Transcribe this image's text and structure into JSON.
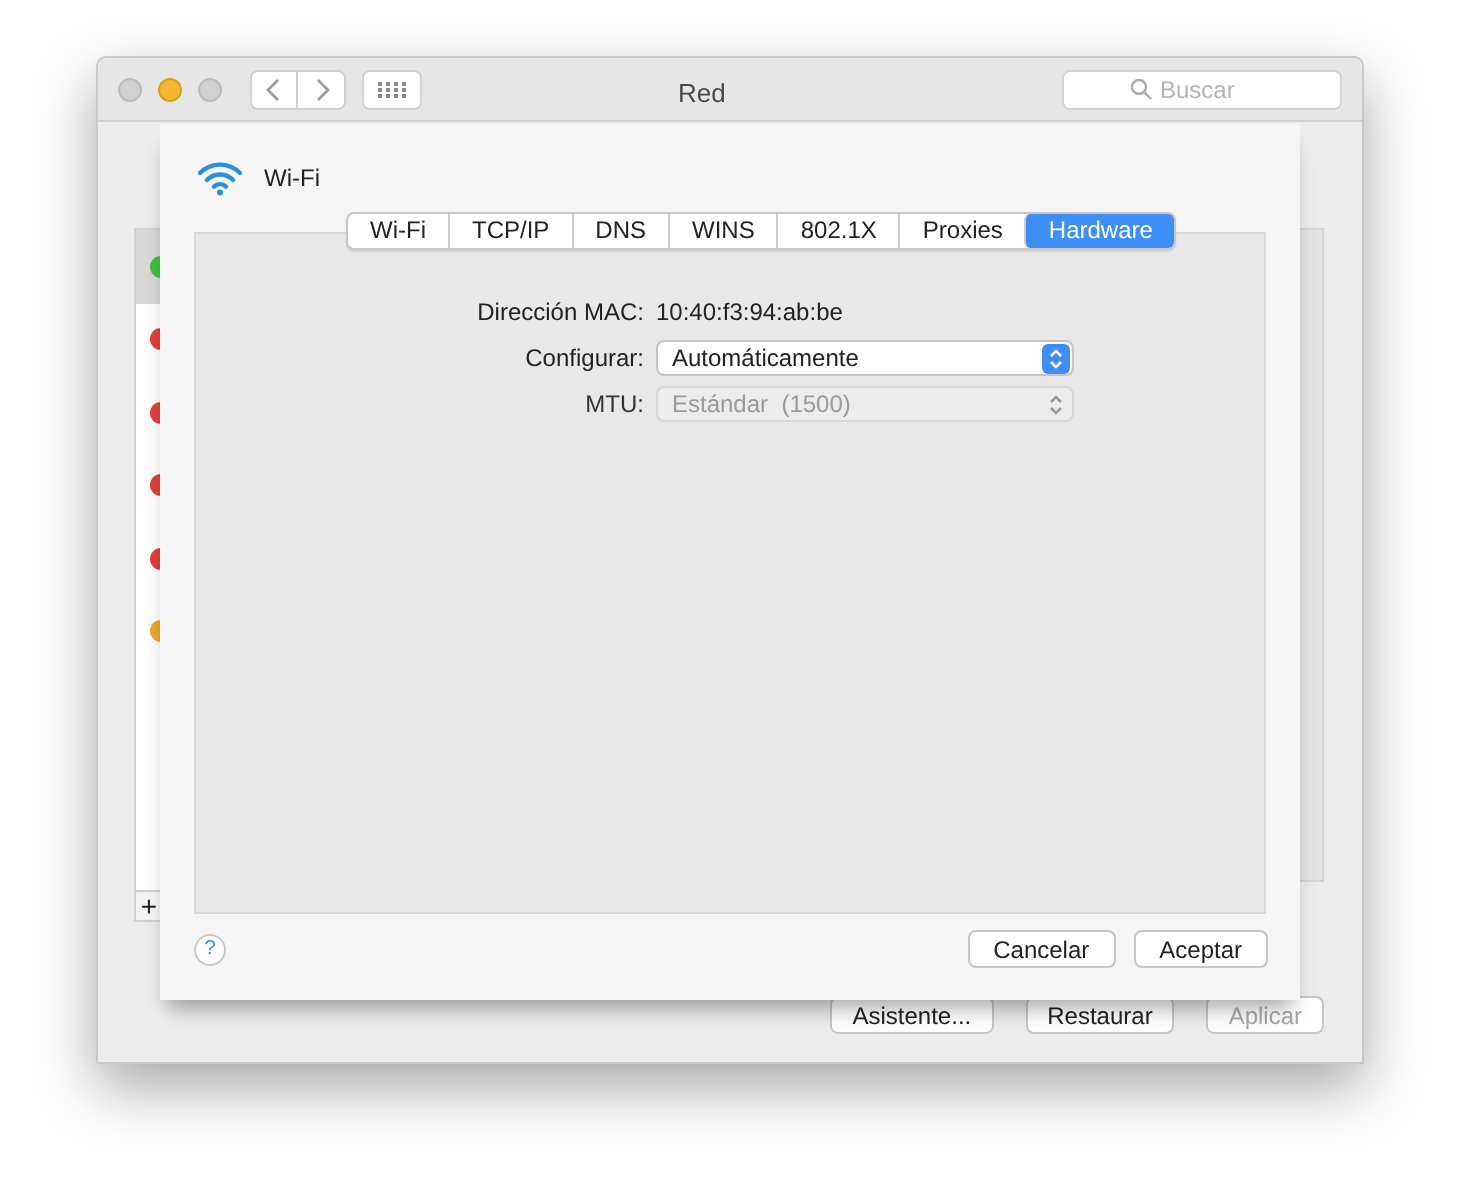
{
  "window": {
    "title": "Red",
    "search": {
      "placeholder": "Buscar"
    }
  },
  "services": [
    {
      "color": "#3fbf3f",
      "selected": true
    },
    {
      "color": "#e0403a",
      "selected": false
    },
    {
      "color": "#e0403a",
      "selected": false
    },
    {
      "color": "#e0403a",
      "selected": false
    },
    {
      "color": "#e0403a",
      "selected": false
    },
    {
      "color": "#e8a82a",
      "selected": false
    }
  ],
  "add_button": "+",
  "bottom_buttons": [
    {
      "label": "Asistente...",
      "disabled": false
    },
    {
      "label": "Restaurar",
      "disabled": false
    },
    {
      "label": "Aplicar",
      "disabled": true
    }
  ],
  "sheet": {
    "title": "Wi-Fi",
    "tabs": [
      {
        "label": "Wi-Fi",
        "selected": false
      },
      {
        "label": "TCP/IP",
        "selected": false
      },
      {
        "label": "DNS",
        "selected": false
      },
      {
        "label": "WINS",
        "selected": false
      },
      {
        "label": "802.1X",
        "selected": false
      },
      {
        "label": "Proxies",
        "selected": false
      },
      {
        "label": "Hardware",
        "selected": true
      }
    ],
    "fields": [
      {
        "kind": "text",
        "label": "Dirección MAC:",
        "value": "10:40:f3:94:ab:be"
      },
      {
        "kind": "popup",
        "label": "Configurar:",
        "value": "Automáticamente",
        "disabled": false
      },
      {
        "kind": "popup",
        "label": "MTU:",
        "value": "Estándar  (1500)",
        "disabled": true
      }
    ],
    "help": "?",
    "buttons": [
      "Cancelar",
      "Aceptar"
    ]
  }
}
